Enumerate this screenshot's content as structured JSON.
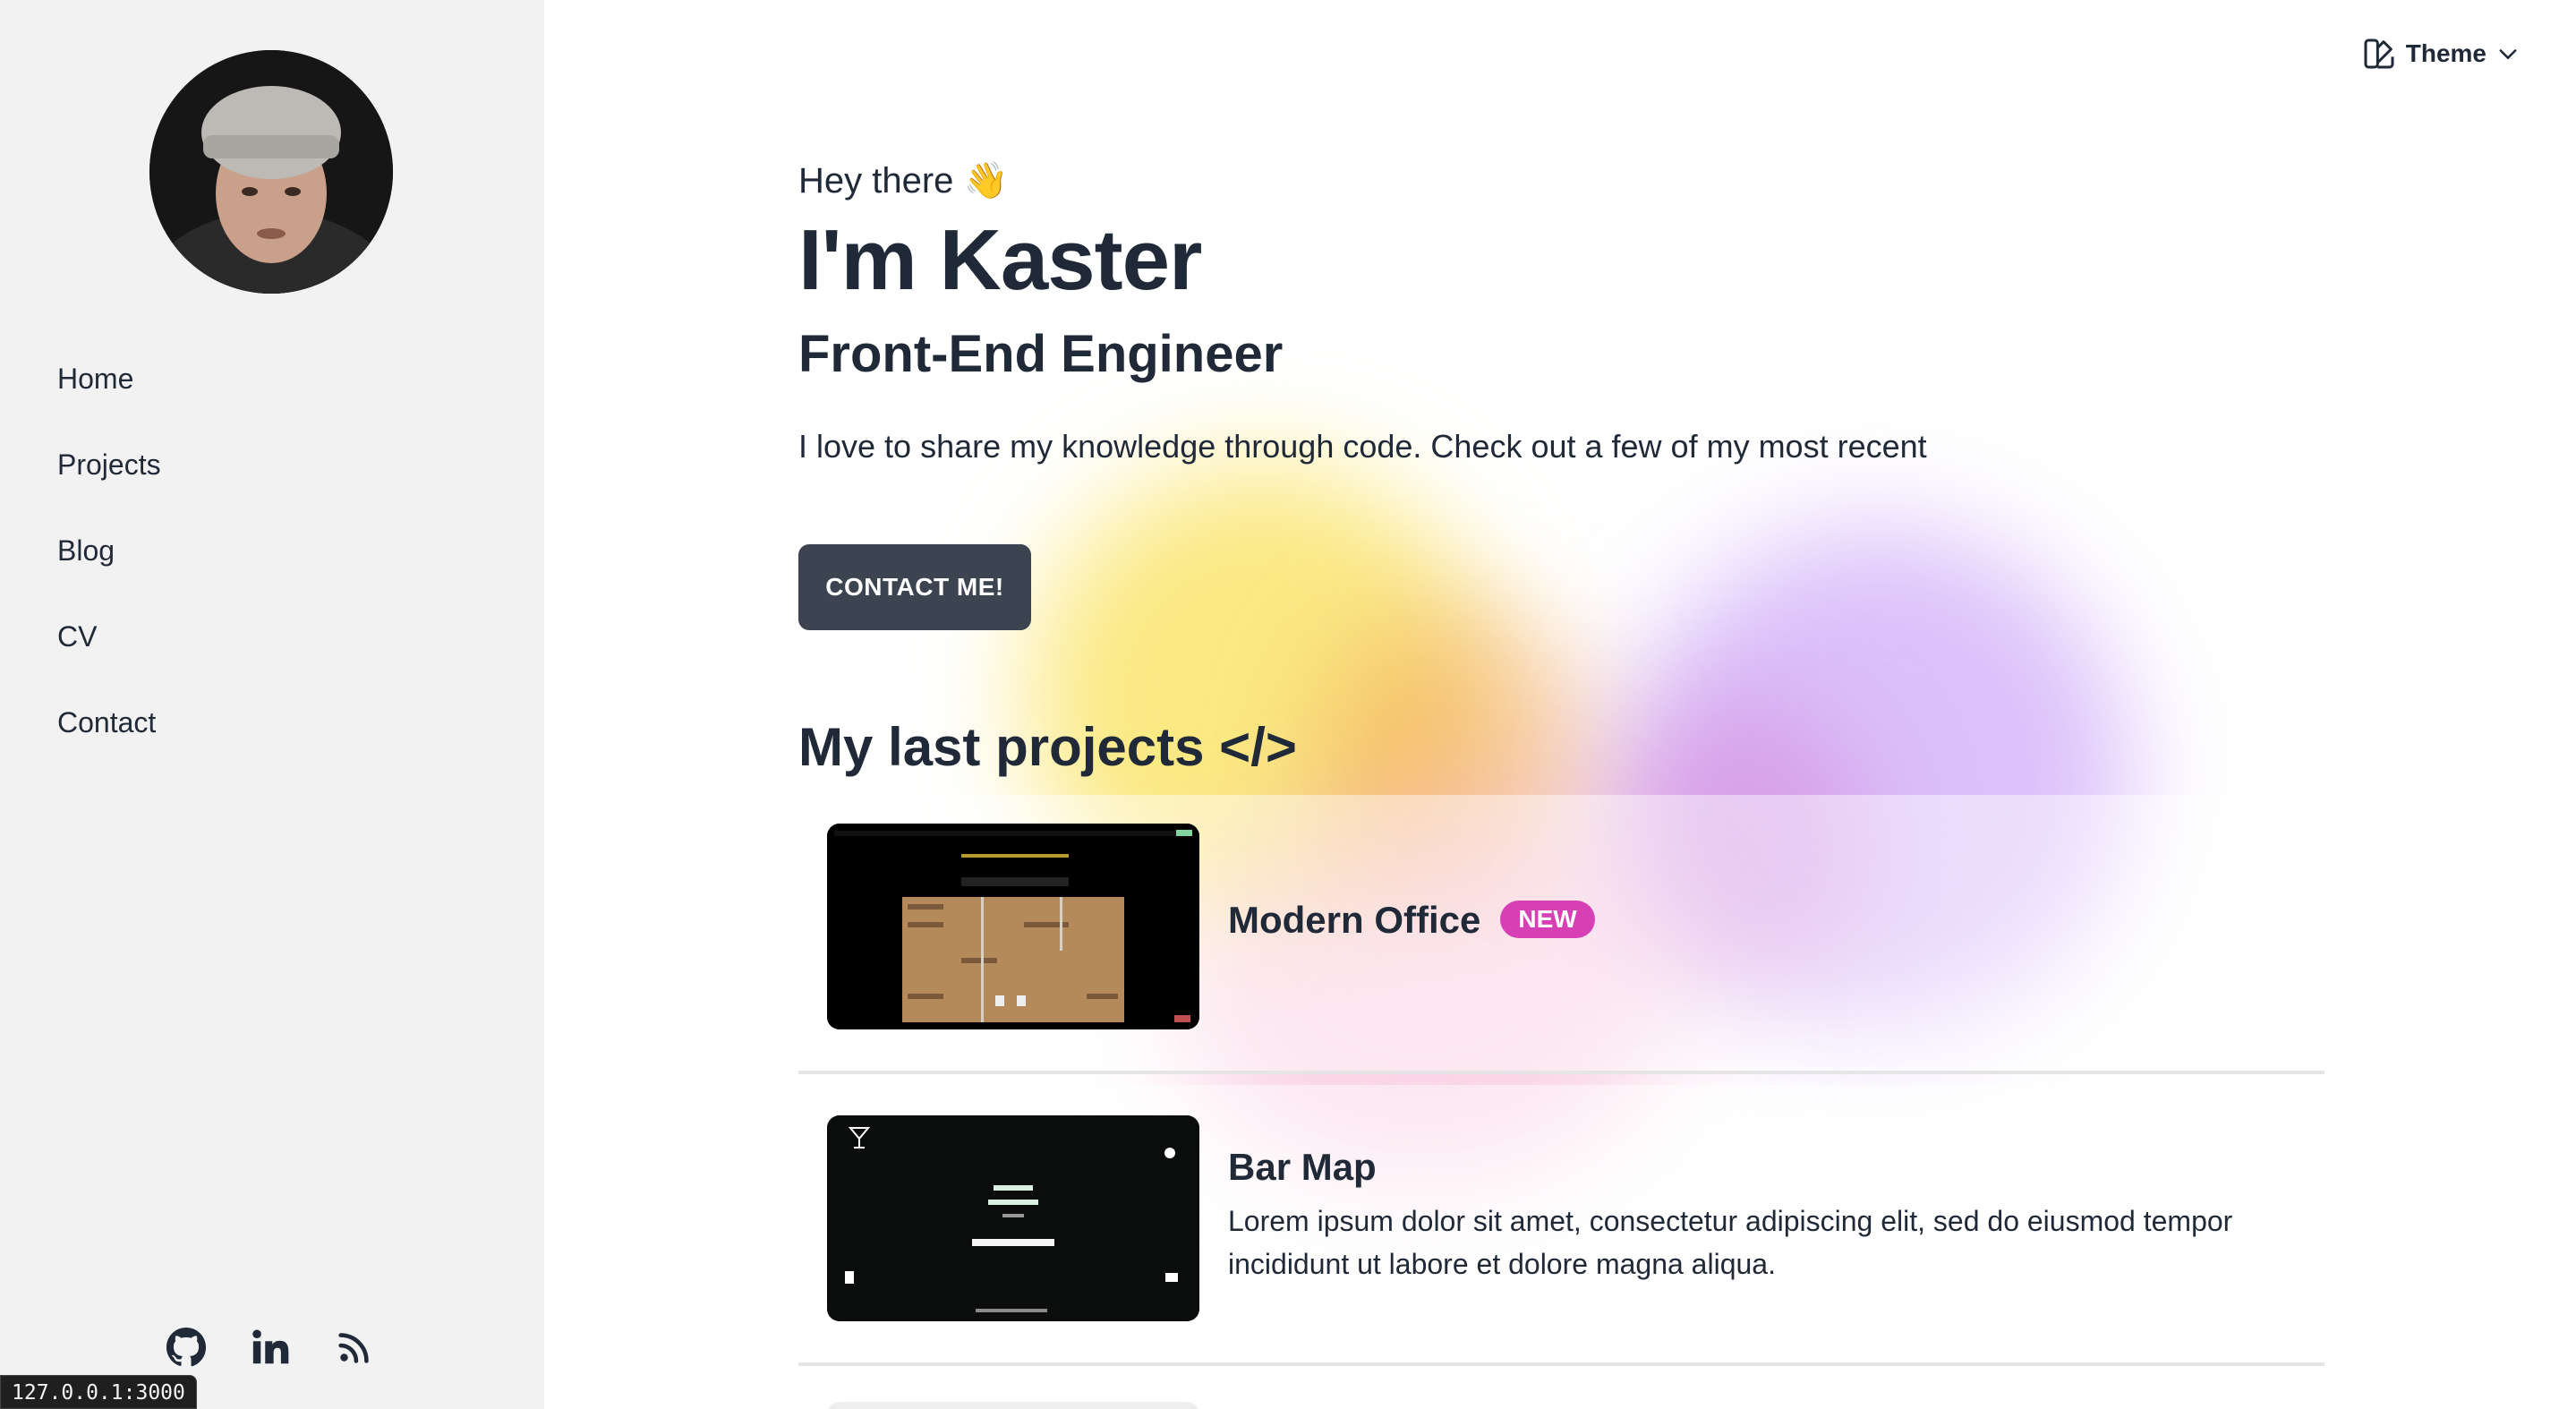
{
  "sidebar": {
    "nav": [
      {
        "label": "Home"
      },
      {
        "label": "Projects"
      },
      {
        "label": "Blog"
      },
      {
        "label": "CV"
      },
      {
        "label": "Contact"
      }
    ],
    "socials": [
      "github-icon",
      "linkedin-icon",
      "rss-icon"
    ]
  },
  "status_bar": {
    "url": "127.0.0.1:3000"
  },
  "header": {
    "theme_label": "Theme"
  },
  "hero": {
    "greeting": "Hey there 👋",
    "name": "I'm Kaster",
    "role": "Front-End Engineer",
    "intro": "I love to share my knowledge through code. Check out a few of my most recent",
    "cta_label": "CONTACT ME!"
  },
  "projects": {
    "title": "My last projects </>",
    "items": [
      {
        "title": "Modern Office",
        "badge": "NEW",
        "description": ""
      },
      {
        "title": "Bar Map",
        "badge": "",
        "description": "Lorem ipsum dolor sit amet, consectetur adipiscing elit, sed do eiusmod tempor incididunt ut labore et dolore magna aliqua."
      }
    ]
  },
  "colors": {
    "sidebar_bg": "#f2f2f2",
    "cta_bg": "#3d4451",
    "badge_bg": "#d73fb4",
    "text": "#1f2937"
  }
}
